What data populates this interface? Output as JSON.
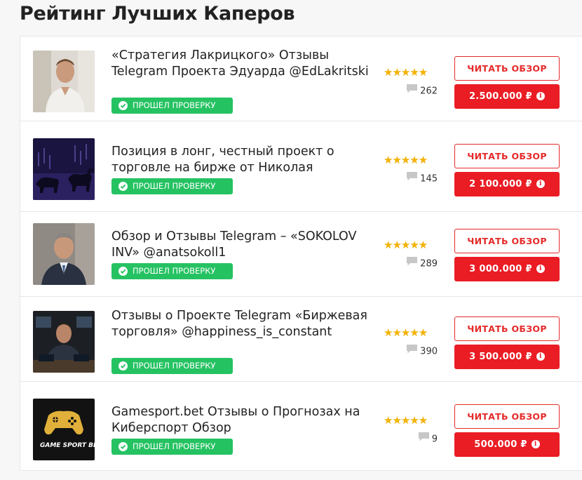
{
  "page": {
    "title": "Рейтинг Лучших Каперов"
  },
  "colors": {
    "accent_red": "#ea1c24",
    "badge_green": "#25c262",
    "star": "#f5b301"
  },
  "items": [
    {
      "title": "«Стратегия Лакрицкого» Отзывы Telegram Проекта Эдуарда @EdLakritski",
      "badge": "ПРОШЕЛ ПРОВЕРКУ",
      "rating": 5,
      "comments": "262",
      "read_label": "ЧИТАТЬ ОБЗОР",
      "price": "2.500.000 ₽",
      "image": "man-portrait-photo"
    },
    {
      "title": "Позиция в лонг, честный проект о торговле на бирже от Николая",
      "badge": "ПРОШЕЛ ПРОВЕРКУ",
      "rating": 5,
      "comments": "145",
      "read_label": "ЧИТАТЬ ОБЗОР",
      "price": "2 100.000 ₽",
      "image": "bull-bear-chart-image"
    },
    {
      "title": "Обзор и Отзывы Telegram – «SOKOLOV INV» @anatsokoll1",
      "badge": "ПРОШЕЛ ПРОВЕРКУ",
      "rating": 5,
      "comments": "289",
      "read_label": "ЧИТАТЬ ОБЗОР",
      "price": "3 000.000 ₽",
      "image": "businessman-portrait-photo"
    },
    {
      "title": "Отзывы о Проекте Telegram «Биржевая торговля» @happiness_is_constant",
      "badge": "ПРОШЕЛ ПРОВЕРКУ",
      "rating": 4.5,
      "comments": "390",
      "read_label": "ЧИТАТЬ ОБЗОР",
      "price": "3 500.000 ₽",
      "image": "trader-at-desk-photo"
    },
    {
      "title": "Gamesport.bet Отзывы о Прогнозах на Киберспорт Обзор",
      "badge": "ПРОШЕЛ ПРОВЕРКУ",
      "rating": 4.5,
      "comments": "9",
      "read_label": "ЧИТАТЬ ОБЗОР",
      "price": "500.000 ₽",
      "image": "gamesport-bet-logo",
      "logo_text": "GAME SPORT BET"
    }
  ]
}
